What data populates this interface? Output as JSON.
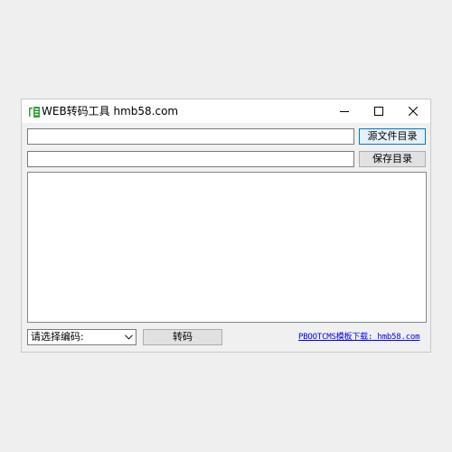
{
  "window": {
    "title": "WEB转码工具 hmb58.com",
    "app_icon": "transcode-app-icon",
    "controls": [
      "minimize-icon",
      "maximize-icon",
      "close-icon"
    ]
  },
  "source": {
    "value": "",
    "button_label": "源文件目录"
  },
  "destination": {
    "value": "",
    "button_label": "保存目录"
  },
  "log": {
    "content": ""
  },
  "encoding_select": {
    "selected": "请选择编码:"
  },
  "convert_button_label": "转码",
  "footer_link": "PBOOTCMS模板下载: hmb58.com",
  "colors": {
    "link": "#0000ff",
    "icon_green": "#2e9e3a",
    "focus_border": "#0078d7"
  }
}
